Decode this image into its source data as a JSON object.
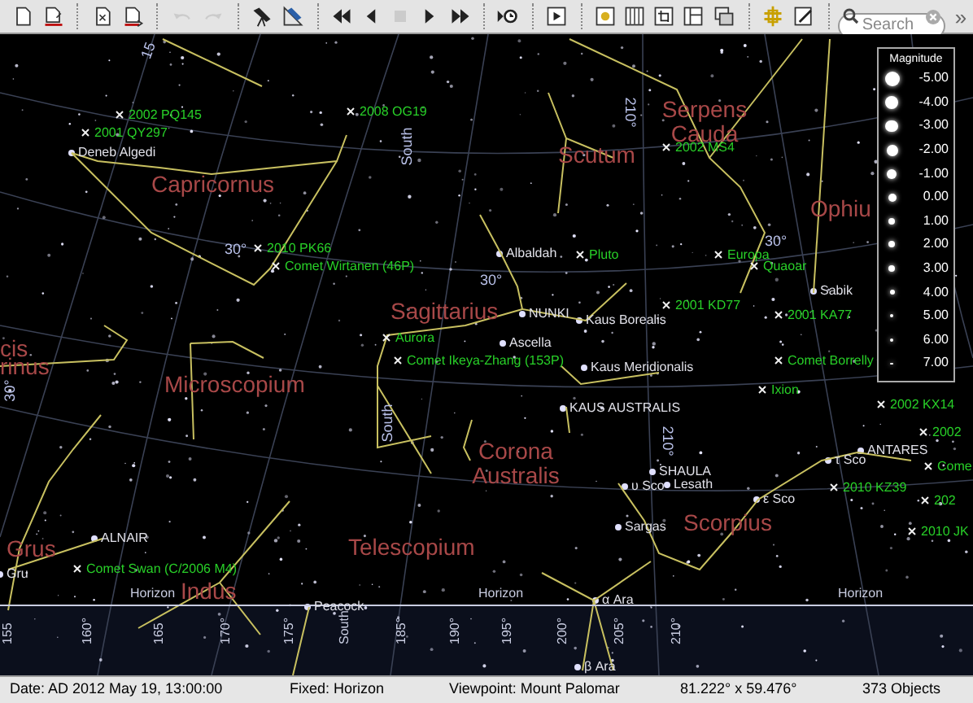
{
  "toolbar": {
    "buttons": [
      {
        "disabled": false
      },
      {
        "disabled": false
      },
      {
        "disabled": false
      },
      {
        "disabled": false
      },
      {
        "disabled": true
      },
      {
        "disabled": true
      },
      {
        "disabled": false
      },
      {
        "disabled": false
      },
      {
        "disabled": false
      },
      {
        "disabled": false
      },
      {
        "disabled": true
      },
      {
        "disabled": false
      },
      {
        "disabled": false
      },
      {
        "disabled": false
      },
      {
        "disabled": false
      },
      {
        "disabled": false
      },
      {
        "disabled": false
      },
      {
        "disabled": false
      },
      {
        "disabled": false
      },
      {
        "disabled": false
      },
      {
        "disabled": false
      },
      {
        "disabled": false
      }
    ],
    "search": {
      "placeholder": "Search"
    },
    "overflow": "»"
  },
  "sky_map": {
    "constellations": [
      {
        "name": "Capricornus"
      },
      {
        "name": "Scutum"
      },
      {
        "name": "Serpens Cauda"
      },
      {
        "name": "Ophiu"
      },
      {
        "name": "Sagittarius"
      },
      {
        "name": "cis"
      },
      {
        "name": "rinus"
      },
      {
        "name": "Microscopium"
      },
      {
        "name": "Corona Australis"
      },
      {
        "name": "Grus"
      },
      {
        "name": "Indus"
      },
      {
        "name": "Telescopium"
      },
      {
        "name": "Scorpius"
      }
    ],
    "stars": [
      {
        "name": "Deneb Algedi"
      },
      {
        "name": "Albaldah"
      },
      {
        "name": "NUNKI"
      },
      {
        "name": "Kaus Borealis"
      },
      {
        "name": "Ascella"
      },
      {
        "name": "Kaus Meridionalis"
      },
      {
        "name": "KAUS AUSTRALIS"
      },
      {
        "name": "Sabik"
      },
      {
        "name": "ANTARES"
      },
      {
        "name": "τ Sco"
      },
      {
        "name": "SHAULA"
      },
      {
        "name": "Lesath"
      },
      {
        "name": "υ Sco"
      },
      {
        "name": "ε Sco"
      },
      {
        "name": "Sargas"
      },
      {
        "name": "ALNAIR"
      },
      {
        "name": "Gru"
      },
      {
        "name": "Peacock"
      },
      {
        "name": "α Ara"
      },
      {
        "name": "β Ara"
      }
    ],
    "objects": [
      {
        "name": "2002 PQ145"
      },
      {
        "name": "2001 QY297"
      },
      {
        "name": "2008 OG19"
      },
      {
        "name": "2010 PK66"
      },
      {
        "name": "Comet Wirtanen (46P)"
      },
      {
        "name": "2002 MS4"
      },
      {
        "name": "Pluto"
      },
      {
        "name": "Europa"
      },
      {
        "name": "Quaoar"
      },
      {
        "name": "2001 KD77"
      },
      {
        "name": "2001 KA77"
      },
      {
        "name": "Aurora"
      },
      {
        "name": "Comet Ikeya-Zhang (153P)"
      },
      {
        "name": "Comet Borrelly"
      },
      {
        "name": "Ixion"
      },
      {
        "name": "2002 KX14"
      },
      {
        "name": "2002"
      },
      {
        "name": "Come"
      },
      {
        "name": "2010 KZ39"
      },
      {
        "name": "202"
      },
      {
        "name": "2010 JK"
      },
      {
        "name": "Comet Swan (C/2006 M4)"
      }
    ],
    "grid_labels": [
      "15",
      "South",
      "210°",
      "30°",
      "30°",
      "30°",
      "South",
      "210°",
      "30°"
    ],
    "horizon_labels": [
      "Horizon",
      "Horizon",
      "Horizon"
    ],
    "azimuth_labels": [
      "155",
      "160°",
      "165",
      "170°",
      "175°",
      "South",
      "185°",
      "190°",
      "195°",
      "200°",
      "205°",
      "210°"
    ],
    "legend": {
      "title": "Magnitude",
      "entries": [
        "-5.00",
        "-4.00",
        "-3.00",
        "-2.00",
        "-1.00",
        "0.00",
        "1.00",
        "2.00",
        "3.00",
        "4.00",
        "5.00",
        "6.00",
        "7.00"
      ]
    }
  },
  "status_bar": {
    "date": "Date: AD 2012 May 19, 13:00:00",
    "fixed": "Fixed: Horizon",
    "viewpoint": "Viewpoint: Mount Palomar",
    "field": "81.222° x 59.476°",
    "count": "373 Objects"
  }
}
